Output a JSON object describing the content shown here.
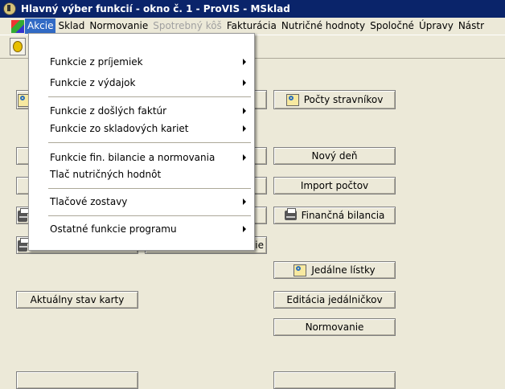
{
  "window": {
    "title": "Hlavný výber funkcií - okno č. 1 - ProVIS - MSklad"
  },
  "menubar": {
    "items": [
      {
        "label": "Akcie",
        "state": "active"
      },
      {
        "label": "Sklad",
        "state": "normal"
      },
      {
        "label": "Normovanie",
        "state": "normal"
      },
      {
        "label": "Spotrebný kôš",
        "state": "disabled"
      },
      {
        "label": "Fakturácia",
        "state": "normal"
      },
      {
        "label": "Nutričné hodnoty",
        "state": "normal"
      },
      {
        "label": "Spoločné",
        "state": "normal"
      },
      {
        "label": "Úpravy",
        "state": "normal"
      },
      {
        "label": "Nástr",
        "state": "normal"
      }
    ]
  },
  "dropdown": {
    "items": [
      {
        "label": "Funkcie z príjemiek",
        "submenu": true
      },
      {
        "label": "Funkcie z výdajok",
        "submenu": true
      },
      {
        "label": "Funkcie z došlých faktúr",
        "submenu": true
      },
      {
        "label": "Funkcie zo skladových kariet",
        "submenu": true
      },
      {
        "label": "Funkcie fin. bilancie a normovania",
        "submenu": true
      },
      {
        "label": "Tlač nutričných hodnôt",
        "submenu": false
      },
      {
        "label": "Tlačové zostavy",
        "submenu": true
      },
      {
        "label": "Ostatné funkcie programu",
        "submenu": true
      }
    ]
  },
  "buttons": {
    "pocty_stravnikov": "Počty stravníkov",
    "novy_den": "Nový deň",
    "import_poctov": "Import počtov",
    "financna_bilancia": "Finančná bilancia",
    "partial_ie": "ie",
    "jedalne_listky": "Jedálne lístky",
    "aktualny_stav_karty": "Aktuálny stav karty",
    "editacia_jedalnickov": "Editácia jedálničkov",
    "normovanie": "Normovanie"
  },
  "icons": {
    "lens": "magnifier-icon",
    "print": "printer-icon"
  }
}
